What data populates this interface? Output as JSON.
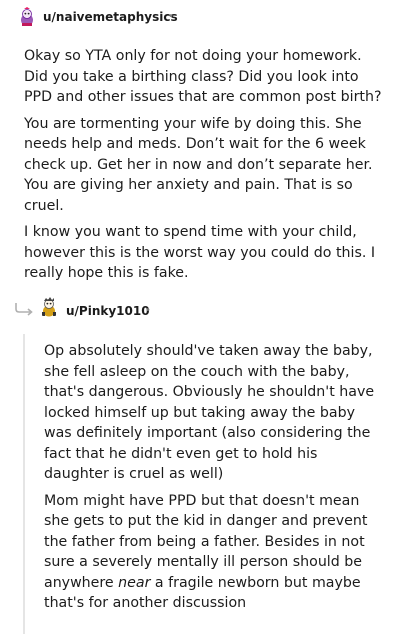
{
  "comments": [
    {
      "username": "u/naivemetaphysics",
      "dot": "•",
      "paragraphs": [
        "Okay so YTA only for not doing your homework. Did you take a birthing class? Did you look into PPD and other issues that are common post birth?",
        "You are tormenting your wife by doing this. She needs help and meds. Don’t wait for the 6 week check up. Get her in now and don’t separate her. You are giving her anxiety and pain. That is so cruel.",
        "I know you want to spend time with your child, however this is the worst way you could do this. I really hope this is fake."
      ]
    },
    {
      "username": "u/Pinky1010",
      "dot": "•",
      "paragraphs": [
        "Op absolutely should've taken away the baby, she fell asleep on the couch with the baby, that's dangerous. Obviously he shouldn't have locked himself up but taking away the baby was definitely important (also considering the fact that he didn't even get to hold his daughter is cruel as well)"
      ],
      "p2_before": "Mom might have PPD but that doesn't mean she gets to put the kid in danger and prevent the father from being a father. Besides in not sure a severely mentally ill person should be anywhere ",
      "p2_emph": "near",
      "p2_after": " a fragile newborn but maybe that's for another discussion"
    }
  ],
  "icons": {
    "avatar1": "snoo-avatar-icon",
    "avatar2": "snoo-avatar-icon",
    "reply": "reply-arrow-icon"
  },
  "colors": {
    "text": "#1c1c1c",
    "meta": "#7c7c7c",
    "thread": "#e5e5e5"
  }
}
